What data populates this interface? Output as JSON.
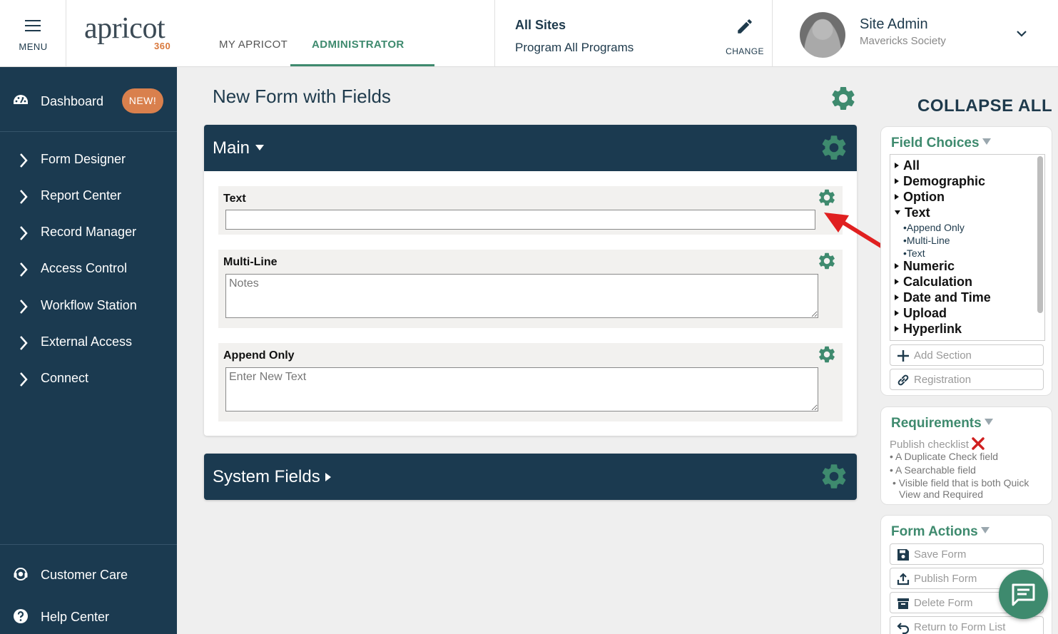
{
  "header": {
    "menu_label": "MENU",
    "logo_text": "apricot",
    "logo_sub": "360",
    "tabs": [
      {
        "label": "MY APRICOT",
        "active": false
      },
      {
        "label": "ADMINISTRATOR",
        "active": true
      }
    ],
    "site": {
      "title": "All Sites",
      "program": "Program All Programs",
      "change_label": "CHANGE"
    },
    "user": {
      "name": "Site Admin",
      "org": "Mavericks Society"
    }
  },
  "sidebar": {
    "dashboard": {
      "label": "Dashboard",
      "badge": "NEW!"
    },
    "items": [
      {
        "label": "Form Designer"
      },
      {
        "label": "Report Center"
      },
      {
        "label": "Record Manager"
      },
      {
        "label": "Access Control"
      },
      {
        "label": "Workflow Station"
      },
      {
        "label": "External Access"
      },
      {
        "label": "Connect"
      }
    ],
    "bottom": [
      {
        "label": "Customer Care"
      },
      {
        "label": "Help Center"
      }
    ]
  },
  "main": {
    "page_title": "New Form with Fields",
    "sections": [
      {
        "title": "Main",
        "fields": [
          {
            "label": "Text",
            "type": "input",
            "value": "",
            "placeholder": ""
          },
          {
            "label": "Multi-Line",
            "type": "textarea",
            "value": "",
            "placeholder": "Notes"
          },
          {
            "label": "Append Only",
            "type": "textarea",
            "value": "",
            "placeholder": "Enter New Text"
          }
        ]
      },
      {
        "title": "System Fields",
        "collapsed": true
      }
    ]
  },
  "right_panel": {
    "collapse_all": "COLLAPSE ALL",
    "field_choices": {
      "title": "Field Choices",
      "categories": [
        {
          "label": "All",
          "expanded": false
        },
        {
          "label": "Demographic",
          "expanded": false
        },
        {
          "label": "Option",
          "expanded": false
        },
        {
          "label": "Text",
          "expanded": true,
          "children": [
            "Append Only",
            "Multi-Line",
            "Text"
          ]
        },
        {
          "label": "Numeric",
          "expanded": false
        },
        {
          "label": "Calculation",
          "expanded": false
        },
        {
          "label": "Date and Time",
          "expanded": false
        },
        {
          "label": "Upload",
          "expanded": false
        },
        {
          "label": "Hyperlink",
          "expanded": false
        }
      ],
      "buttons": [
        "Add Section",
        "Registration"
      ]
    },
    "requirements": {
      "title": "Requirements",
      "checklist_label": "Publish checklist",
      "items": [
        "A Duplicate Check field",
        "A Searchable field",
        "Visible field that is both Quick View and Required"
      ]
    },
    "form_actions": {
      "title": "Form Actions",
      "buttons": [
        "Save Form",
        "Publish Form",
        "Delete Form",
        "Return to Form List"
      ]
    }
  },
  "colors": {
    "navy": "#1b3a50",
    "accent_green": "#3e8a6e",
    "badge_orange": "#d9804d",
    "arrow_red": "#e02020"
  }
}
